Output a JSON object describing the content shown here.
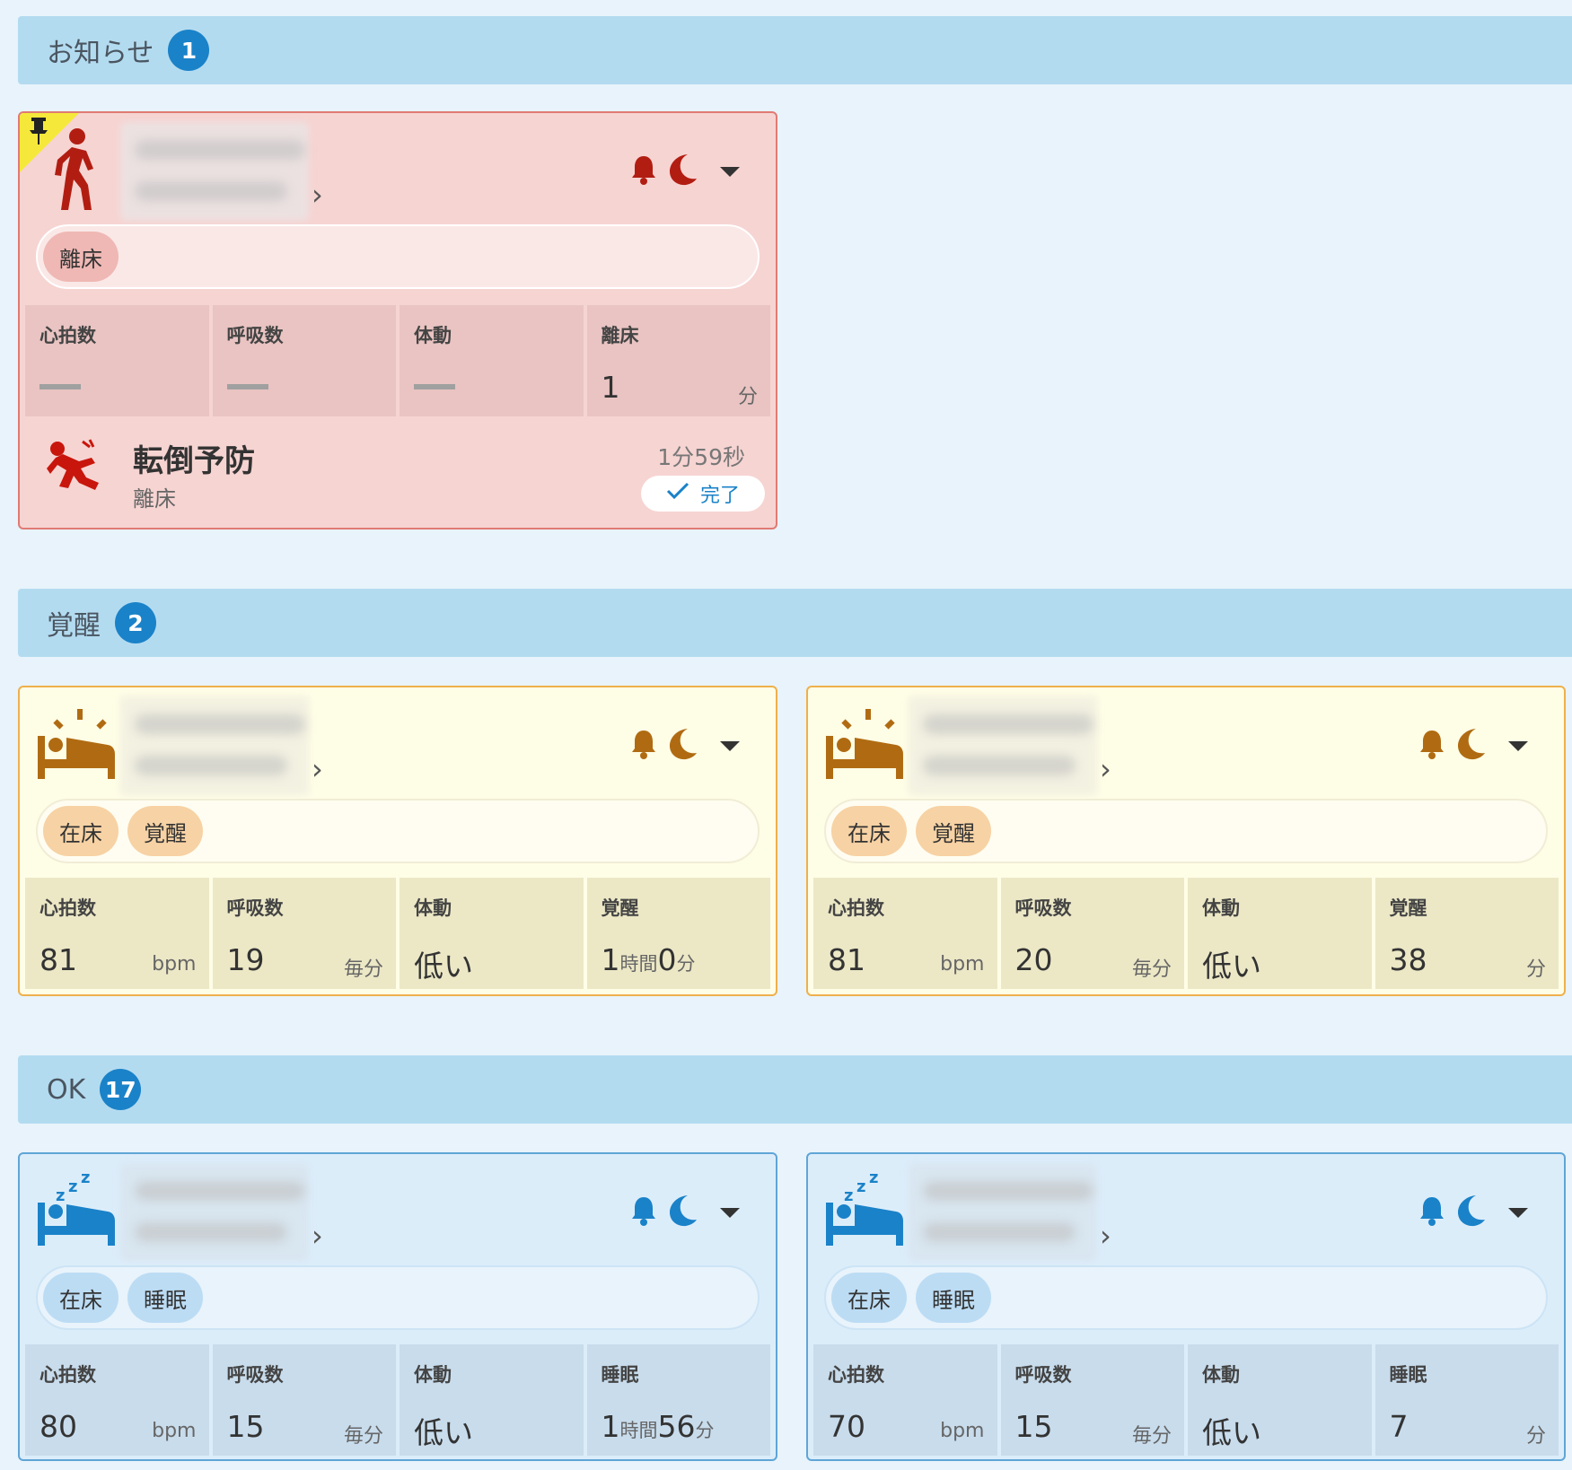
{
  "sections": [
    {
      "title": "お知らせ",
      "count": "1"
    },
    {
      "title": "覚醒",
      "count": "2"
    },
    {
      "title": "OK",
      "count": "17"
    }
  ],
  "colors": {
    "alert": "#b21d12",
    "awake": "#b06b12",
    "ok": "#1a82c8"
  },
  "alert_card": {
    "tags": [
      "離床"
    ],
    "stats": [
      {
        "label": "心拍数",
        "value": "—",
        "unit": ""
      },
      {
        "label": "呼吸数",
        "value": "—",
        "unit": ""
      },
      {
        "label": "体動",
        "value": "—",
        "unit": ""
      },
      {
        "label": "離床",
        "value": "1",
        "unit": "分"
      }
    ],
    "footer": {
      "title": "転倒予防",
      "subtitle": "離床",
      "elapsed": "1分59秒",
      "done_label": "完了"
    }
  },
  "awake_cards": [
    {
      "tags": [
        "在床",
        "覚醒"
      ],
      "stats": [
        {
          "label": "心拍数",
          "value": "81",
          "unit": "bpm"
        },
        {
          "label": "呼吸数",
          "value": "19",
          "unit": "毎分"
        },
        {
          "label": "体動",
          "value": "低い",
          "unit": ""
        },
        {
          "label": "覚醒",
          "value_parts": [
            "1",
            "時間",
            "0",
            "分"
          ]
        }
      ]
    },
    {
      "tags": [
        "在床",
        "覚醒"
      ],
      "stats": [
        {
          "label": "心拍数",
          "value": "81",
          "unit": "bpm"
        },
        {
          "label": "呼吸数",
          "value": "20",
          "unit": "毎分"
        },
        {
          "label": "体動",
          "value": "低い",
          "unit": ""
        },
        {
          "label": "覚醒",
          "value": "38",
          "unit": "分"
        }
      ]
    }
  ],
  "ok_cards": [
    {
      "tags": [
        "在床",
        "睡眠"
      ],
      "stats": [
        {
          "label": "心拍数",
          "value": "80",
          "unit": "bpm"
        },
        {
          "label": "呼吸数",
          "value": "15",
          "unit": "毎分"
        },
        {
          "label": "体動",
          "value": "低い",
          "unit": ""
        },
        {
          "label": "睡眠",
          "value_parts": [
            "1",
            "時間",
            "56",
            "分"
          ]
        }
      ]
    },
    {
      "tags": [
        "在床",
        "睡眠"
      ],
      "stats": [
        {
          "label": "心拍数",
          "value": "70",
          "unit": "bpm"
        },
        {
          "label": "呼吸数",
          "value": "15",
          "unit": "毎分"
        },
        {
          "label": "体動",
          "value": "低い",
          "unit": ""
        },
        {
          "label": "睡眠",
          "value": "7",
          "unit": "分"
        }
      ]
    }
  ]
}
